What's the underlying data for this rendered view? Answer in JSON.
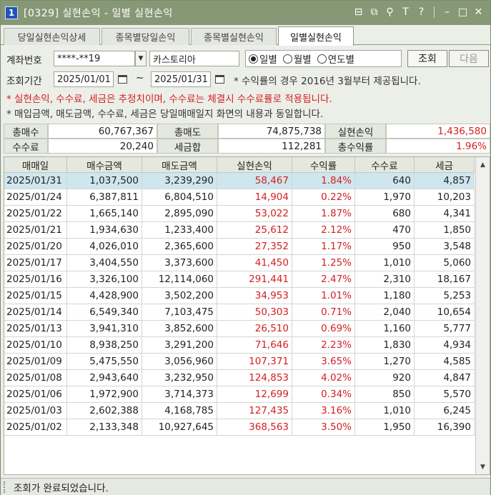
{
  "window": {
    "number": "1",
    "title": "[0329] 실현손익 - 일별 실현손익"
  },
  "title_icons": [
    "layout-icon",
    "copy-icon",
    "pin-icon",
    "text-icon",
    "help-icon",
    "minimize-icon",
    "maximize-icon",
    "close-icon"
  ],
  "title_icon_glyphs": [
    "⊟",
    "⧉",
    "⚲",
    "T",
    "?",
    "–",
    "□",
    "✕"
  ],
  "tabs": [
    {
      "label": "당일실현손익상세"
    },
    {
      "label": "종목별당일손익"
    },
    {
      "label": "종목별실현손익"
    },
    {
      "label": "일별실현손익"
    }
  ],
  "query": {
    "account_label": "계좌번호",
    "account_value": "****-**19",
    "account_name": "카스토리아",
    "period_label": "조회기간",
    "date_from": "2025/01/01",
    "tilde": "~",
    "date_to": "2025/01/31",
    "radios": [
      {
        "label": "일별",
        "checked": true
      },
      {
        "label": "월별",
        "checked": false
      },
      {
        "label": "연도별",
        "checked": false
      }
    ],
    "search_button": "조회",
    "next_button": "다음",
    "rate_note": "* 수익률의 경우 2016년 3월부터 제공됩니다."
  },
  "notes": {
    "red": "* 실현손익, 수수료, 세금은 추정치이며, 수수료는 체결시 수수료률로 적용됩니다.",
    "dark": "* 매입금액, 매도금액, 수수료, 세금은 당일매매일지 화면의 내용과 동일합니다."
  },
  "summary": {
    "total_buy_label": "총매수",
    "total_buy": "60,767,367",
    "total_sell_label": "총매도",
    "total_sell": "74,875,738",
    "realized_label": "실현손익",
    "realized": "1,436,580",
    "fee_label": "수수료",
    "fee": "20,240",
    "tax_label": "세금합",
    "tax": "112,281",
    "return_label": "총수익률",
    "return": "1.96%"
  },
  "table": {
    "columns": [
      "매매일",
      "매수금액",
      "매도금액",
      "실현손익",
      "수익률",
      "수수료",
      "세금"
    ],
    "rows": [
      [
        "2025/01/31",
        "1,037,500",
        "3,239,290",
        "58,467",
        "1.84%",
        "640",
        "4,857"
      ],
      [
        "2025/01/24",
        "6,387,811",
        "6,804,510",
        "14,904",
        "0.22%",
        "1,970",
        "10,203"
      ],
      [
        "2025/01/22",
        "1,665,140",
        "2,895,090",
        "53,022",
        "1.87%",
        "680",
        "4,341"
      ],
      [
        "2025/01/21",
        "1,934,630",
        "1,233,400",
        "25,612",
        "2.12%",
        "470",
        "1,850"
      ],
      [
        "2025/01/20",
        "4,026,010",
        "2,365,600",
        "27,352",
        "1.17%",
        "950",
        "3,548"
      ],
      [
        "2025/01/17",
        "3,404,550",
        "3,373,600",
        "41,450",
        "1.25%",
        "1,010",
        "5,060"
      ],
      [
        "2025/01/16",
        "3,326,100",
        "12,114,060",
        "291,441",
        "2.47%",
        "2,310",
        "18,167"
      ],
      [
        "2025/01/15",
        "4,428,900",
        "3,502,200",
        "34,953",
        "1.01%",
        "1,180",
        "5,253"
      ],
      [
        "2025/01/14",
        "6,549,340",
        "7,103,475",
        "50,303",
        "0.71%",
        "2,040",
        "10,654"
      ],
      [
        "2025/01/13",
        "3,941,310",
        "3,852,600",
        "26,510",
        "0.69%",
        "1,160",
        "5,777"
      ],
      [
        "2025/01/10",
        "8,938,250",
        "3,291,200",
        "71,646",
        "2.23%",
        "1,830",
        "4,934"
      ],
      [
        "2025/01/09",
        "5,475,550",
        "3,056,960",
        "107,371",
        "3.65%",
        "1,270",
        "4,585"
      ],
      [
        "2025/01/08",
        "2,943,640",
        "3,232,950",
        "124,853",
        "4.02%",
        "920",
        "4,847"
      ],
      [
        "2025/01/06",
        "1,972,900",
        "3,714,373",
        "12,699",
        "0.34%",
        "850",
        "5,570"
      ],
      [
        "2025/01/03",
        "2,602,388",
        "4,168,785",
        "127,435",
        "3.16%",
        "1,010",
        "6,245"
      ],
      [
        "2025/01/02",
        "2,133,348",
        "10,927,645",
        "368,563",
        "3.50%",
        "1,950",
        "16,390"
      ]
    ],
    "selected_row": 0
  },
  "status": "조회가 완료되었습니다.",
  "colors": {
    "titlebar": "#879877",
    "profit_red": "#d42020",
    "selected_row": "#cfe6ef"
  }
}
